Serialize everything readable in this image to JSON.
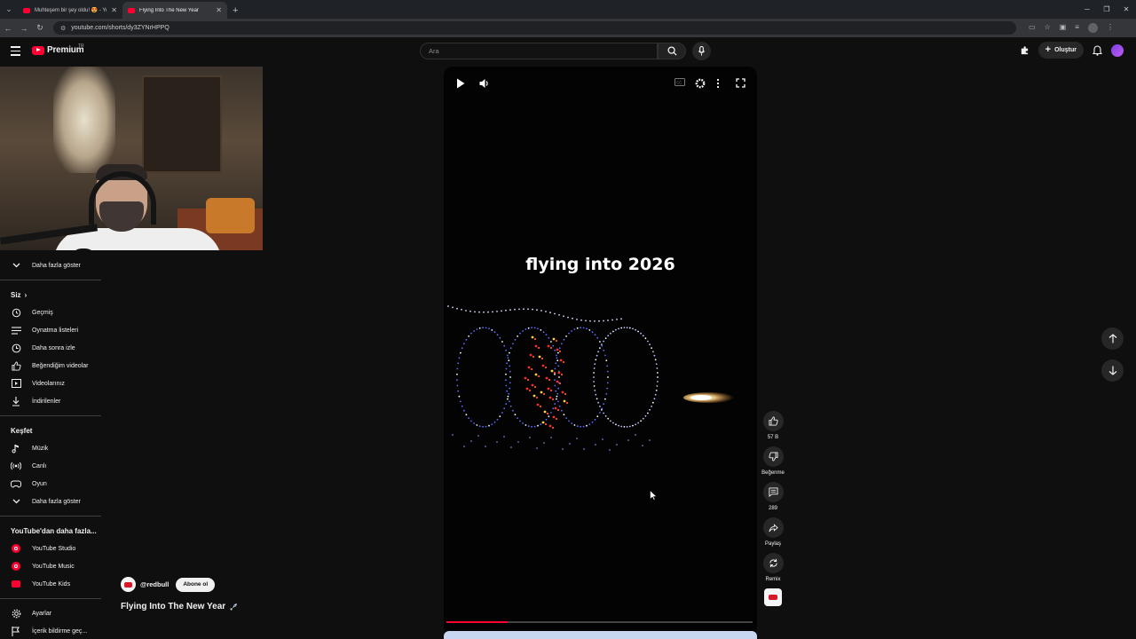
{
  "browser": {
    "tabs": [
      {
        "title": "Muhteşem bir şey oldu! 😍 - YouTube",
        "active": false
      },
      {
        "title": "Flying Into The New Year",
        "active": true
      }
    ],
    "new_tab": "+",
    "url": "youtube.com/shorts/dy3ZYNrHPPQ"
  },
  "header": {
    "logo_text": "Premium",
    "country_code": "TR",
    "search_placeholder": "Ara",
    "create_label": "Oluştur"
  },
  "sidebar": {
    "show_more_top": "Daha fazla göster",
    "you_section": "Siz",
    "you_items": [
      {
        "label": "Geçmiş",
        "icon": "history-icon"
      },
      {
        "label": "Oynatma listeleri",
        "icon": "playlist-icon"
      },
      {
        "label": "Daha sonra izle",
        "icon": "watch-later-icon"
      },
      {
        "label": "Beğendiğim videolar",
        "icon": "like-icon"
      },
      {
        "label": "Videolarınız",
        "icon": "your-videos-icon"
      },
      {
        "label": "İndirilenler",
        "icon": "download-icon"
      }
    ],
    "explore_section": "Keşfet",
    "explore_items": [
      {
        "label": "Müzik",
        "icon": "music-icon"
      },
      {
        "label": "Canlı",
        "icon": "live-icon"
      },
      {
        "label": "Oyun",
        "icon": "gaming-icon"
      }
    ],
    "show_more_explore": "Daha fazla göster",
    "more_section": "YouTube'dan daha fazla...",
    "more_items": [
      {
        "label": "YouTube Studio",
        "icon": "youtube-studio-icon"
      },
      {
        "label": "YouTube Music",
        "icon": "youtube-music-icon"
      },
      {
        "label": "YouTube Kids",
        "icon": "youtube-kids-icon"
      }
    ],
    "settings": "Ayarlar",
    "report": "İçerik bildirme geç..."
  },
  "player": {
    "overlay_text": "flying into 2026",
    "progress": 0.2
  },
  "short": {
    "channel": "@redbull",
    "subscribe": "Abone ol",
    "title": "Flying Into The New Year"
  },
  "actions": {
    "like_count": "57 B",
    "dislike_label": "Beğenme",
    "comment_count": "289",
    "share_label": "Paylaş",
    "remix_label": "Remix"
  },
  "colors": {
    "accent": "#ff0033",
    "background": "#0f0f0f"
  }
}
